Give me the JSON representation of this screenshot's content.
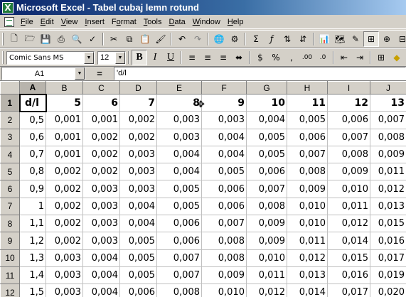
{
  "window": {
    "title": "Microsoft Excel - Tabel cubaj lemn rotund",
    "app_icon": "X"
  },
  "menu": [
    {
      "pre": "",
      "key": "F",
      "post": "ile"
    },
    {
      "pre": "",
      "key": "E",
      "post": "dit"
    },
    {
      "pre": "",
      "key": "V",
      "post": "iew"
    },
    {
      "pre": "",
      "key": "I",
      "post": "nsert"
    },
    {
      "pre": "F",
      "key": "o",
      "post": "rmat"
    },
    {
      "pre": "",
      "key": "T",
      "post": "ools"
    },
    {
      "pre": "",
      "key": "D",
      "post": "ata"
    },
    {
      "pre": "",
      "key": "W",
      "post": "indow"
    },
    {
      "pre": "",
      "key": "H",
      "post": "elp"
    }
  ],
  "toolbar": {
    "font": "Comic Sans MS",
    "size": "12",
    "bold": "B",
    "italic": "I",
    "underline": "U"
  },
  "formula_bar": {
    "name_box": "A1",
    "equals": "=",
    "content": "'d/l"
  },
  "columns": [
    "A",
    "B",
    "C",
    "D",
    "E",
    "F",
    "G",
    "H",
    "I",
    "J"
  ],
  "rows": [
    {
      "n": "1",
      "cells": [
        "d/l",
        "5",
        "6",
        "7",
        "8",
        "9",
        "10",
        "11",
        "12",
        "13"
      ]
    },
    {
      "n": "2",
      "cells": [
        "0,5",
        "0,001",
        "0,001",
        "0,002",
        "0,003",
        "0,003",
        "0,004",
        "0,005",
        "0,006",
        "0,007"
      ]
    },
    {
      "n": "3",
      "cells": [
        "0,6",
        "0,001",
        "0,002",
        "0,002",
        "0,003",
        "0,004",
        "0,005",
        "0,006",
        "0,007",
        "0,008"
      ]
    },
    {
      "n": "4",
      "cells": [
        "0,7",
        "0,001",
        "0,002",
        "0,003",
        "0,004",
        "0,004",
        "0,005",
        "0,007",
        "0,008",
        "0,009"
      ]
    },
    {
      "n": "5",
      "cells": [
        "0,8",
        "0,002",
        "0,002",
        "0,003",
        "0,004",
        "0,005",
        "0,006",
        "0,008",
        "0,009",
        "0,011"
      ]
    },
    {
      "n": "6",
      "cells": [
        "0,9",
        "0,002",
        "0,003",
        "0,003",
        "0,005",
        "0,006",
        "0,007",
        "0,009",
        "0,010",
        "0,012"
      ]
    },
    {
      "n": "7",
      "cells": [
        "1",
        "0,002",
        "0,003",
        "0,004",
        "0,005",
        "0,006",
        "0,008",
        "0,010",
        "0,011",
        "0,013"
      ]
    },
    {
      "n": "8",
      "cells": [
        "1,1",
        "0,002",
        "0,003",
        "0,004",
        "0,006",
        "0,007",
        "0,009",
        "0,010",
        "0,012",
        "0,015"
      ]
    },
    {
      "n": "9",
      "cells": [
        "1,2",
        "0,002",
        "0,003",
        "0,005",
        "0,006",
        "0,008",
        "0,009",
        "0,011",
        "0,014",
        "0,016"
      ]
    },
    {
      "n": "10",
      "cells": [
        "1,3",
        "0,003",
        "0,004",
        "0,005",
        "0,007",
        "0,008",
        "0,010",
        "0,012",
        "0,015",
        "0,017"
      ]
    },
    {
      "n": "11",
      "cells": [
        "1,4",
        "0,003",
        "0,004",
        "0,005",
        "0,007",
        "0,009",
        "0,011",
        "0,013",
        "0,016",
        "0,019"
      ]
    },
    {
      "n": "12",
      "cells": [
        "1,5",
        "0,003",
        "0,004",
        "0,006",
        "0,008",
        "0,010",
        "0,012",
        "0,014",
        "0,017",
        "0,020"
      ]
    }
  ],
  "cursor_glyph": "✥"
}
